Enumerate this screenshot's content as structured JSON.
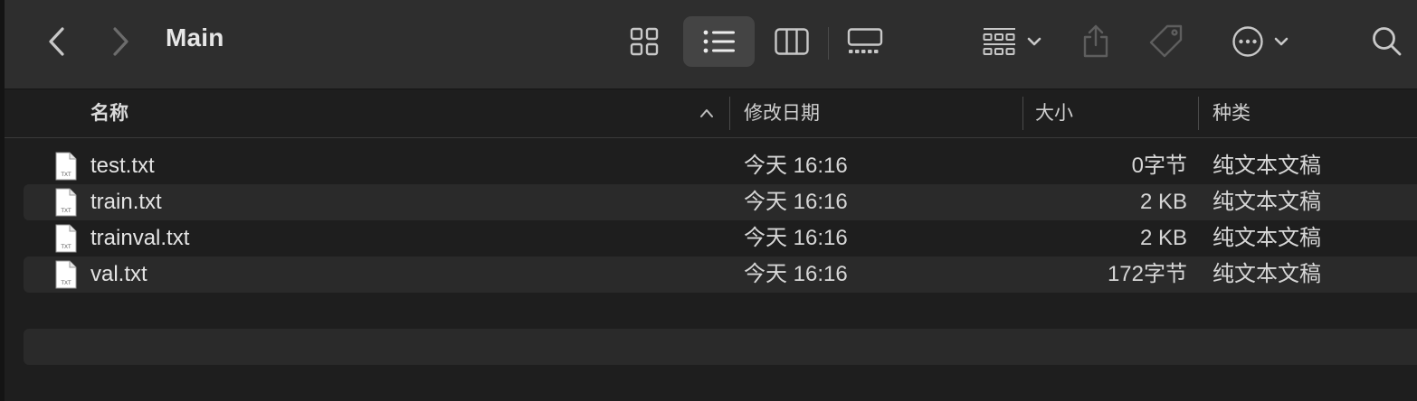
{
  "window": {
    "title": "Main"
  },
  "toolbar": {
    "icons": [
      "chevron-left-icon",
      "chevron-right-icon",
      "grid-view-icon",
      "list-view-icon",
      "column-view-icon",
      "gallery-view-icon",
      "group-icon",
      "chevron-down-icon",
      "share-icon",
      "tag-icon",
      "more-icon",
      "chevron-down-icon",
      "search-icon"
    ],
    "active_view": "list"
  },
  "table": {
    "columns": {
      "name": "名称",
      "date": "修改日期",
      "size": "大小",
      "kind": "种类"
    },
    "sort": "ascending",
    "rows": [
      {
        "name": "test.txt",
        "date": "今天 16:16",
        "size": "0字节",
        "kind": "纯文本文稿"
      },
      {
        "name": "train.txt",
        "date": "今天 16:16",
        "size": "2 KB",
        "kind": "纯文本文稿"
      },
      {
        "name": "trainval.txt",
        "date": "今天 16:16",
        "size": "2 KB",
        "kind": "纯文本文稿"
      },
      {
        "name": "val.txt",
        "date": "今天 16:16",
        "size": "172字节",
        "kind": "纯文本文稿"
      }
    ]
  },
  "file_icon_label": "TXT",
  "colors": {
    "toolbar_bg": "#2e2e2e",
    "content_bg": "#1e1e1e",
    "stripe_bg": "#2a2a2a",
    "active_button_bg": "#444444",
    "text": "#e4e4e4"
  }
}
